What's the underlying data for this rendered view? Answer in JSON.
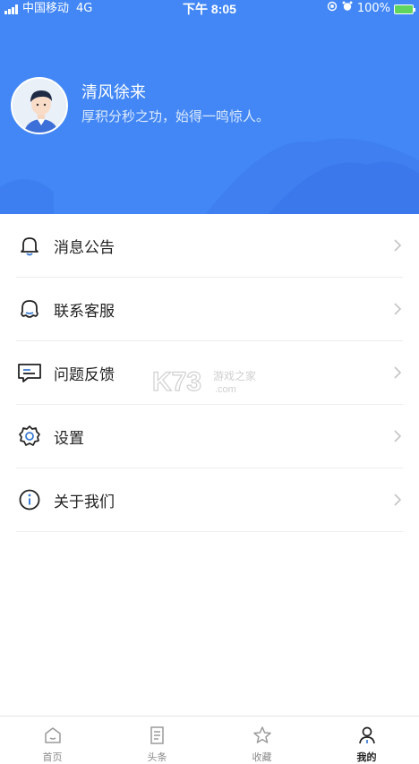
{
  "statusbar": {
    "carrier": "中国移动",
    "network": "4G",
    "time": "下午 8:05",
    "battery": "100%"
  },
  "profile": {
    "name": "清风徐来",
    "motto": "厚积分秒之功，始得一鸣惊人。"
  },
  "menu": [
    {
      "label": "消息公告",
      "icon": "bell-icon"
    },
    {
      "label": "联系客服",
      "icon": "customer-service-icon"
    },
    {
      "label": "问题反馈",
      "icon": "feedback-icon"
    },
    {
      "label": "设置",
      "icon": "gear-icon"
    },
    {
      "label": "关于我们",
      "icon": "info-icon"
    }
  ],
  "watermark": {
    "text": "K73",
    "sub": "游戏之家",
    "domain": ".com"
  },
  "tabs": [
    {
      "label": "首页",
      "icon": "home-icon",
      "active": false
    },
    {
      "label": "头条",
      "icon": "news-icon",
      "active": false
    },
    {
      "label": "收藏",
      "icon": "star-icon",
      "active": false
    },
    {
      "label": "我的",
      "icon": "user-icon",
      "active": true
    }
  ],
  "colors": {
    "header": "#4287f5",
    "accent": "#3a7bd5"
  }
}
